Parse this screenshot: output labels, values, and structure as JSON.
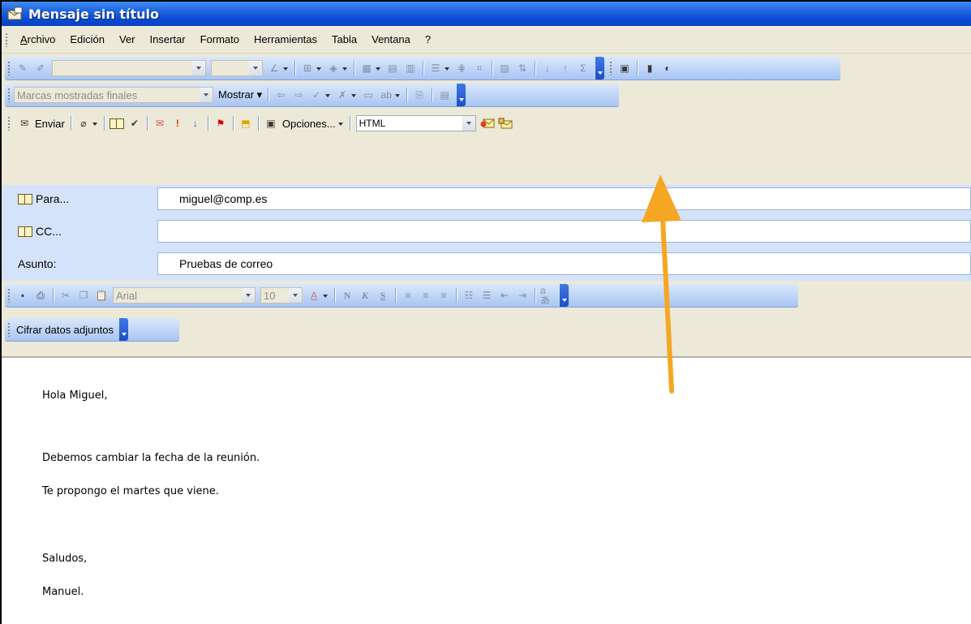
{
  "window": {
    "title": "Mensaje sin título"
  },
  "menubar": {
    "items": [
      {
        "label": "Archivo"
      },
      {
        "label": "Edición"
      },
      {
        "label": "Ver"
      },
      {
        "label": "Insertar"
      },
      {
        "label": "Formato"
      },
      {
        "label": "Herramientas"
      },
      {
        "label": "Tabla"
      },
      {
        "label": "Ventana"
      },
      {
        "label": "?"
      }
    ]
  },
  "review_toolbar": {
    "markup_combo": "Marcas mostradas finales",
    "show_label": "Mostrar"
  },
  "mail_toolbar": {
    "send_label": "Enviar",
    "options_label": "Opciones...",
    "format_value": "HTML"
  },
  "headers": {
    "to_label": "Para...",
    "to_value": "miguel@comp.es",
    "cc_label": "CC...",
    "cc_value": "",
    "subject_label": "Asunto:",
    "subject_value": "Pruebas de correo"
  },
  "format_toolbar": {
    "font_name": "Arial",
    "font_size": "10",
    "bold": "N",
    "italic": "K",
    "underline": "S"
  },
  "encrypt_toolbar": {
    "label": "Cifrar datos adjuntos"
  },
  "message_body": {
    "lines": [
      "Hola Miguel,",
      "Debemos cambiar la fecha de la reunión.",
      "Te propongo el martes que viene.",
      "Saludos,",
      "Manuel."
    ]
  },
  "annotation": {
    "arrow_color": "#f5a623"
  }
}
